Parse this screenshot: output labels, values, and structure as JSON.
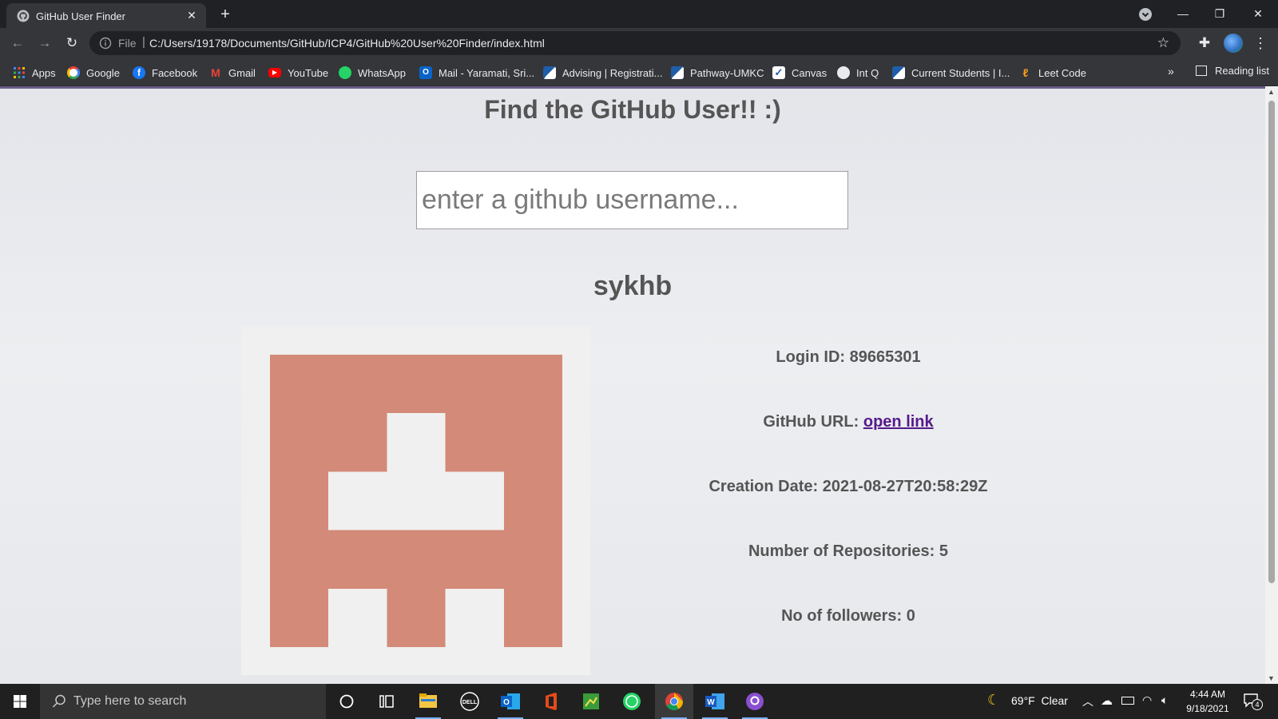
{
  "browser": {
    "tab_title": "GitHub User Finder",
    "omnibox_scheme": "File",
    "url": "C:/Users/19178/Documents/GitHub/ICP4/GitHub%20User%20Finder/index.html",
    "bookmarks": [
      "Apps",
      "Google",
      "Facebook",
      "Gmail",
      "YouTube",
      "WhatsApp",
      "Mail - Yaramati, Sri...",
      "Advising | Registrati...",
      "Pathway-UMKC",
      "Canvas",
      "Int Q",
      "Current Students | I...",
      "Leet Code"
    ],
    "reading_list": "Reading list",
    "more": "»"
  },
  "page": {
    "title": "Find the GitHub User!! :)",
    "search_placeholder": "enter a github username...",
    "username": "sykhb",
    "avatar_color": "#d38a78",
    "info": {
      "login_label": "Login ID: ",
      "login_value": "89665301",
      "url_label": "GitHub URL: ",
      "url_link": "open link",
      "created_label": "Creation Date: ",
      "created_value": "2021-08-27T20:58:29Z",
      "repos_label": "Number of Repositories: ",
      "repos_value": "5",
      "followers_label": "No of followers: ",
      "followers_value": "0"
    }
  },
  "taskbar": {
    "search_placeholder": "Type here to search",
    "weather": "69°F  Clear",
    "time": "4:44 AM",
    "date": "9/18/2021",
    "notifications": "4"
  }
}
